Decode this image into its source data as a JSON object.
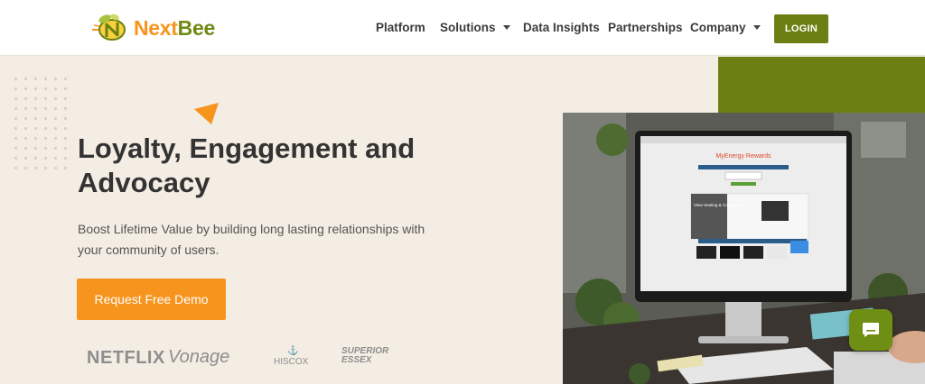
{
  "brand": {
    "name_part1": "Next",
    "name_part2": "Bee",
    "accent_orange": "#f7941d",
    "accent_green": "#6b7f12"
  },
  "nav": {
    "items": [
      {
        "label": "Platform",
        "has_dropdown": false
      },
      {
        "label": "Solutions",
        "has_dropdown": true
      },
      {
        "label": "Data Insights",
        "has_dropdown": false
      },
      {
        "label": "Partnerships",
        "has_dropdown": false
      },
      {
        "label": "Company",
        "has_dropdown": true
      }
    ],
    "login_label": "LOGIN"
  },
  "hero": {
    "title": "Loyalty, Engagement and Advocacy",
    "subtitle": "Boost Lifetime Value by building long lasting relationships with your community of users.",
    "cta_label": "Request Free Demo"
  },
  "clients": {
    "netflix": "NETFLIX",
    "vonage": "Vonage",
    "hiscox": "HISCOX",
    "superior_line1": "SUPERIOR",
    "superior_line2": "ESSEX"
  },
  "screen": {
    "brand": "MyEnergy Rewards",
    "promo_title": "View Heating & Cooling Pack"
  },
  "icons": [
    "logo-bee-icon",
    "caret-down-icon",
    "chat-icon",
    "triangle-decoration"
  ]
}
